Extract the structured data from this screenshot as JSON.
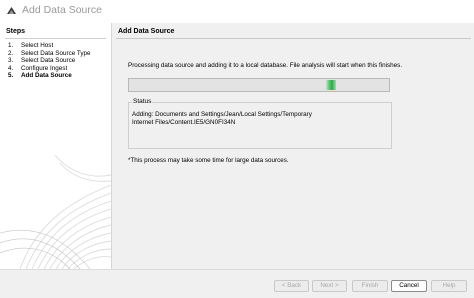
{
  "window": {
    "title": "Add Data Source",
    "icon": "app-logo-icon"
  },
  "steps": {
    "header": "Steps",
    "items": [
      {
        "num": "1.",
        "label": "Select Host"
      },
      {
        "num": "2.",
        "label": "Select Data Source Type"
      },
      {
        "num": "3.",
        "label": "Select Data Source"
      },
      {
        "num": "4.",
        "label": "Configure Ingest"
      },
      {
        "num": "5.",
        "label": "Add Data Source",
        "active": true
      }
    ]
  },
  "main": {
    "header": "Add Data Source",
    "processing_text": "Processing data source and adding it to a local database. File analysis will start when this finishes.",
    "progress": {
      "mode": "indeterminate",
      "accent": "#2fa84c"
    },
    "status": {
      "legend": "Status",
      "text": "Adding: Documents and Settings/Jean/Local Settings/Temporary Internet Files/Content.IE5/GN0FI34N"
    },
    "note": "*This process may take some time for large data sources."
  },
  "buttons": {
    "back": {
      "label": "< Back",
      "enabled": false
    },
    "next": {
      "label": "Next >",
      "enabled": false
    },
    "finish": {
      "label": "Finish",
      "enabled": false
    },
    "cancel": {
      "label": "Cancel",
      "enabled": true
    },
    "help": {
      "label": "Help",
      "enabled": false
    }
  }
}
